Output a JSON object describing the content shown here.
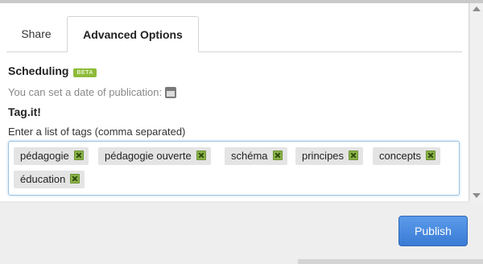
{
  "tabs": [
    {
      "label": "Share"
    },
    {
      "label": "Advanced Options"
    }
  ],
  "scheduling": {
    "title": "Scheduling",
    "badge": "BETA",
    "hint": "You can set a date of publication:",
    "calendar_icon": "calendar-icon"
  },
  "tagit": {
    "title": "Tag.it!",
    "field_label": "Enter a list of tags (comma separated)",
    "tags": [
      "pédagogie",
      "pédagogie ouverte",
      "schéma",
      "principes",
      "concepts",
      "éducation"
    ],
    "remove_icon": "close-icon"
  },
  "footer": {
    "publish_label": "Publish"
  },
  "colors": {
    "accent": "#3a7bd5",
    "badge": "#8dbb3a",
    "tag_remove": "#8cb34a",
    "focus_border": "#9cc3e6"
  }
}
